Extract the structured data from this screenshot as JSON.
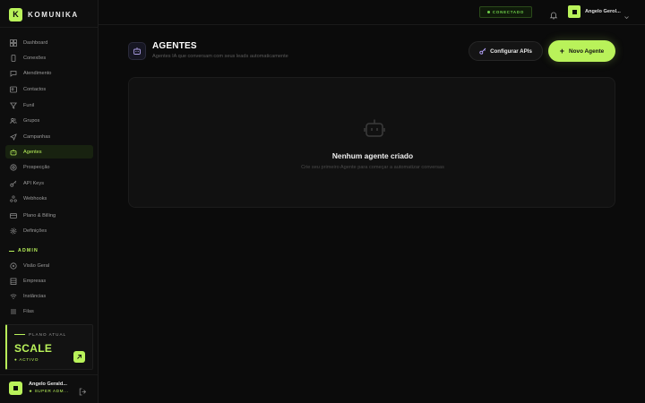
{
  "brand": {
    "logo_letter": "K",
    "name": "KOMUNIKA"
  },
  "sidebar": {
    "items": [
      {
        "label": "Dashboard",
        "icon": "grid-icon",
        "active": false
      },
      {
        "label": "Conexões",
        "icon": "phone-icon",
        "active": false
      },
      {
        "label": "Atendimento",
        "icon": "chat-icon",
        "active": false
      },
      {
        "label": "Contactos",
        "icon": "contacts-icon",
        "active": false
      },
      {
        "label": "Funil",
        "icon": "filter-icon",
        "active": false
      },
      {
        "label": "Grupos",
        "icon": "users-icon",
        "active": false
      },
      {
        "label": "Campanhas",
        "icon": "send-icon",
        "active": false
      },
      {
        "label": "Agentes",
        "icon": "bot-icon",
        "active": true
      },
      {
        "label": "Prospecção",
        "icon": "target-icon",
        "active": false
      },
      {
        "label": "API Keys",
        "icon": "key-icon",
        "active": false
      },
      {
        "label": "Webhooks",
        "icon": "webhook-icon",
        "active": false
      },
      {
        "label": "Plano & Billing",
        "icon": "card-icon",
        "active": false
      },
      {
        "label": "Definições",
        "icon": "gear-icon",
        "active": false
      }
    ],
    "admin_heading": "ADMIN",
    "admin_items": [
      {
        "label": "Visão Geral",
        "icon": "eye-icon"
      },
      {
        "label": "Empresas",
        "icon": "building-icon"
      },
      {
        "label": "Instâncias",
        "icon": "wifi-icon"
      },
      {
        "label": "Filas",
        "icon": "list-icon"
      }
    ],
    "plan": {
      "label": "PLANO ATUAL",
      "name": "SCALE",
      "status": "● ACTIVO"
    },
    "user": {
      "name": "Angelo Gerald...",
      "role": "★ SUPER ADM..."
    }
  },
  "topbar": {
    "status": "CONECTADO",
    "user_name": "Angelo Gerol..."
  },
  "main": {
    "title": "AGENTES",
    "subtitle": "Agentes IA que conversam com seus leads automaticamente",
    "config_button": "Configurar APIs",
    "new_button": "Novo Agente",
    "empty_title": "Nenhum agente criado",
    "empty_subtitle": "Crie seu primeiro Agente para começar a automatizar conversas"
  },
  "colors": {
    "accent": "#b9f25a",
    "background": "#0b0b0b",
    "card": "#111111"
  }
}
